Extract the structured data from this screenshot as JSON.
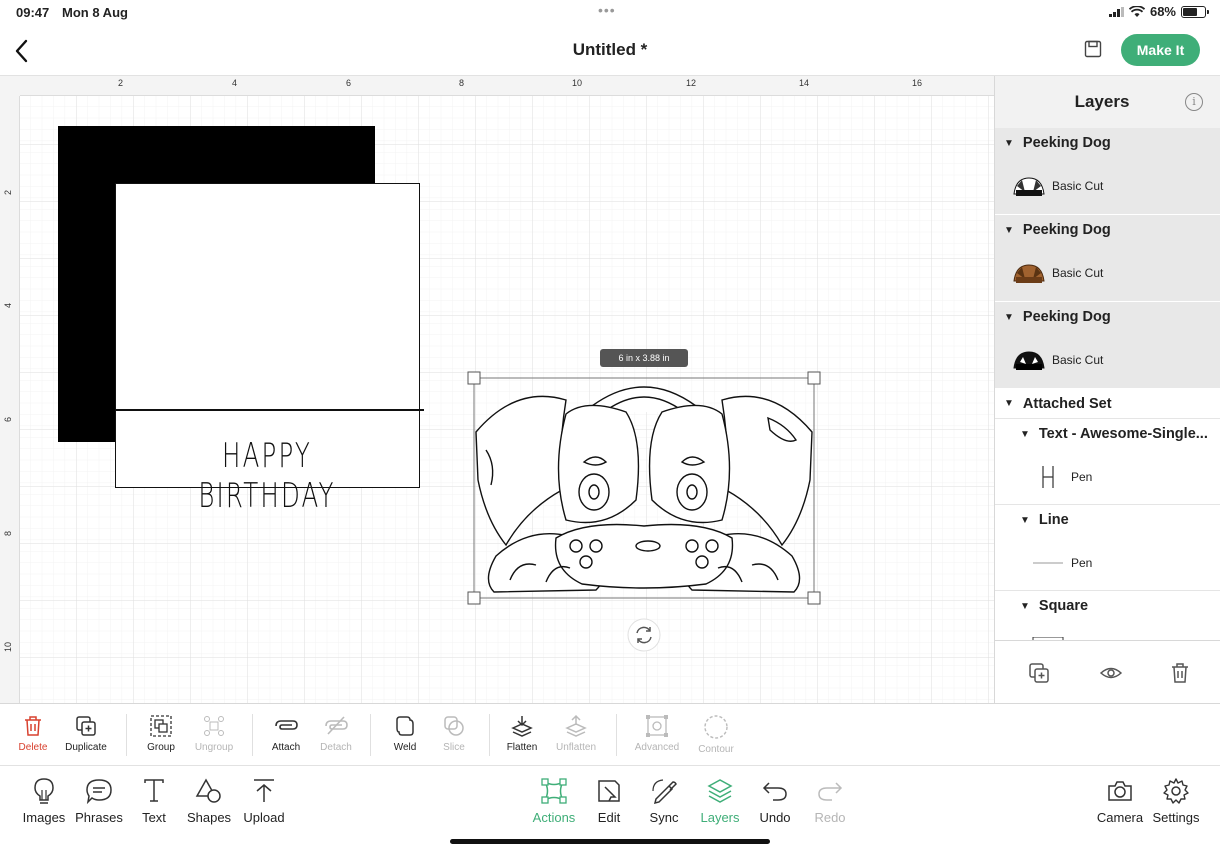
{
  "status_bar": {
    "time": "09:47",
    "date": "Mon 8 Aug",
    "battery": "68%"
  },
  "header": {
    "title": "Untitled *",
    "make_it_label": "Make It"
  },
  "canvas": {
    "ruler_top_labels": [
      "2",
      "4",
      "6",
      "8",
      "10",
      "12",
      "14",
      "16"
    ],
    "ruler_left_labels": [
      "2",
      "4",
      "6",
      "8",
      "10"
    ],
    "card_text": "HAPPY BIRTHDAY",
    "selection_size": "6 in x 3.88 in"
  },
  "layers": {
    "title": "Layers",
    "groups": [
      {
        "name": "Peeking Dog",
        "operation": "Basic Cut"
      },
      {
        "name": "Peeking Dog",
        "operation": "Basic Cut"
      },
      {
        "name": "Peeking Dog",
        "operation": "Basic Cut"
      }
    ],
    "attached_set": {
      "name": "Attached Set",
      "children": [
        {
          "name": "Text - Awesome-Single...",
          "operation": "Pen"
        },
        {
          "name": "Line",
          "operation": "Pen"
        },
        {
          "name": "Square",
          "operation": ""
        }
      ]
    }
  },
  "actions": {
    "delete": "Delete",
    "duplicate": "Duplicate",
    "group": "Group",
    "ungroup": "Ungroup",
    "attach": "Attach",
    "detach": "Detach",
    "weld": "Weld",
    "slice": "Slice",
    "flatten": "Flatten",
    "unflatten": "Unflatten",
    "advanced": "Advanced",
    "contour": "Contour"
  },
  "bottom_nav": {
    "images": "Images",
    "phrases": "Phrases",
    "text": "Text",
    "shapes": "Shapes",
    "upload": "Upload",
    "actions": "Actions",
    "edit": "Edit",
    "sync": "Sync",
    "layers": "Layers",
    "undo": "Undo",
    "redo": "Redo",
    "camera": "Camera",
    "settings": "Settings"
  },
  "colors": {
    "accent": "#3fae78",
    "delete": "#d8412f",
    "disabled": "#b5b5b5"
  }
}
